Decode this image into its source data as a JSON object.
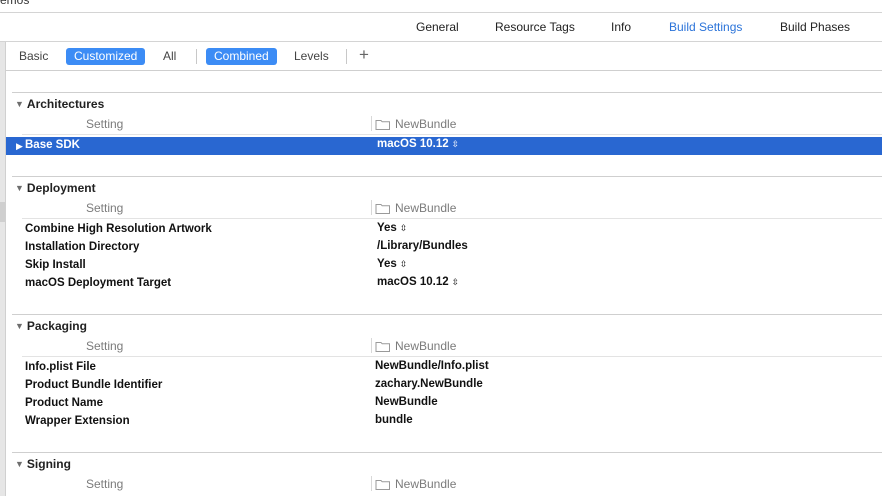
{
  "window_fragment": "emos",
  "tabs": [
    {
      "label": "General",
      "active": false
    },
    {
      "label": "Resource Tags",
      "active": false
    },
    {
      "label": "Info",
      "active": false
    },
    {
      "label": "Build Settings",
      "active": true
    },
    {
      "label": "Build Phases",
      "active": false
    }
  ],
  "filters": {
    "basic": "Basic",
    "customized": "Customized",
    "all": "All",
    "combined": "Combined",
    "levels": "Levels",
    "add": "+"
  },
  "column_setting_label": "Setting",
  "target_name": "NewBundle",
  "colors": {
    "accent": "#2a73d9",
    "selected_row": "#2967d1",
    "segment_selected": "#3c8cf5"
  },
  "sections": {
    "architectures": {
      "title": "Architectures",
      "rows": [
        {
          "name": "Base SDK",
          "value": "macOS 10.12",
          "stepper": true,
          "selected": true
        }
      ]
    },
    "deployment": {
      "title": "Deployment",
      "rows": [
        {
          "name": "Combine High Resolution Artwork",
          "value": "Yes",
          "stepper": true
        },
        {
          "name": "Installation Directory",
          "value": "/Library/Bundles",
          "stepper": false
        },
        {
          "name": "Skip Install",
          "value": "Yes",
          "stepper": true
        },
        {
          "name": "macOS Deployment Target",
          "value": "macOS 10.12",
          "stepper": true
        }
      ]
    },
    "packaging": {
      "title": "Packaging",
      "rows": [
        {
          "name": "Info.plist File",
          "value": "NewBundle/Info.plist",
          "stepper": false
        },
        {
          "name": "Product Bundle Identifier",
          "value": "zachary.NewBundle",
          "stepper": false
        },
        {
          "name": "Product Name",
          "value": "NewBundle",
          "stepper": false
        },
        {
          "name": "Wrapper Extension",
          "value": "bundle",
          "stepper": false
        }
      ]
    },
    "signing": {
      "title": "Signing",
      "rows": []
    }
  }
}
